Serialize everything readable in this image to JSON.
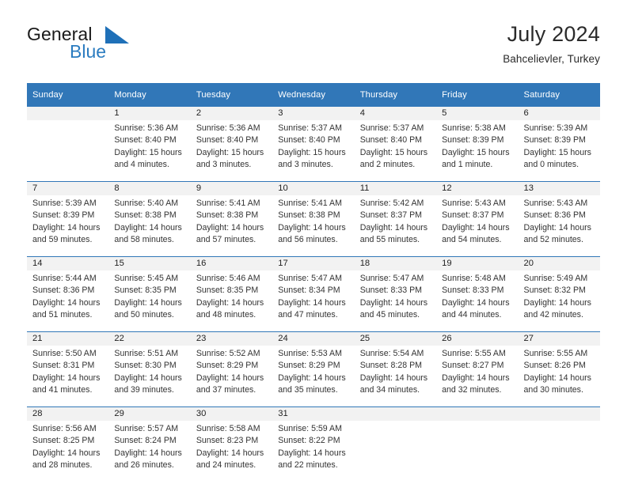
{
  "brand": {
    "line1": "General",
    "line2": "Blue",
    "triangle_icon": "brand-triangle-icon",
    "accent_color": "#2b7cc0"
  },
  "header": {
    "title": "July 2024",
    "subtitle": "Bahcelievler, Turkey"
  },
  "theme": {
    "header_blue": "#3177b8",
    "daynum_bg": "#f2f2f2",
    "text": "#333333"
  },
  "calendar": {
    "weekday_headers": [
      "Sunday",
      "Monday",
      "Tuesday",
      "Wednesday",
      "Thursday",
      "Friday",
      "Saturday"
    ],
    "weeks": [
      [
        {
          "day": "",
          "sunrise": "",
          "sunset": "",
          "daylight1": "",
          "daylight2": ""
        },
        {
          "day": "1",
          "sunrise": "Sunrise: 5:36 AM",
          "sunset": "Sunset: 8:40 PM",
          "daylight1": "Daylight: 15 hours",
          "daylight2": "and 4 minutes."
        },
        {
          "day": "2",
          "sunrise": "Sunrise: 5:36 AM",
          "sunset": "Sunset: 8:40 PM",
          "daylight1": "Daylight: 15 hours",
          "daylight2": "and 3 minutes."
        },
        {
          "day": "3",
          "sunrise": "Sunrise: 5:37 AM",
          "sunset": "Sunset: 8:40 PM",
          "daylight1": "Daylight: 15 hours",
          "daylight2": "and 3 minutes."
        },
        {
          "day": "4",
          "sunrise": "Sunrise: 5:37 AM",
          "sunset": "Sunset: 8:40 PM",
          "daylight1": "Daylight: 15 hours",
          "daylight2": "and 2 minutes."
        },
        {
          "day": "5",
          "sunrise": "Sunrise: 5:38 AM",
          "sunset": "Sunset: 8:39 PM",
          "daylight1": "Daylight: 15 hours",
          "daylight2": "and 1 minute."
        },
        {
          "day": "6",
          "sunrise": "Sunrise: 5:39 AM",
          "sunset": "Sunset: 8:39 PM",
          "daylight1": "Daylight: 15 hours",
          "daylight2": "and 0 minutes."
        }
      ],
      [
        {
          "day": "7",
          "sunrise": "Sunrise: 5:39 AM",
          "sunset": "Sunset: 8:39 PM",
          "daylight1": "Daylight: 14 hours",
          "daylight2": "and 59 minutes."
        },
        {
          "day": "8",
          "sunrise": "Sunrise: 5:40 AM",
          "sunset": "Sunset: 8:38 PM",
          "daylight1": "Daylight: 14 hours",
          "daylight2": "and 58 minutes."
        },
        {
          "day": "9",
          "sunrise": "Sunrise: 5:41 AM",
          "sunset": "Sunset: 8:38 PM",
          "daylight1": "Daylight: 14 hours",
          "daylight2": "and 57 minutes."
        },
        {
          "day": "10",
          "sunrise": "Sunrise: 5:41 AM",
          "sunset": "Sunset: 8:38 PM",
          "daylight1": "Daylight: 14 hours",
          "daylight2": "and 56 minutes."
        },
        {
          "day": "11",
          "sunrise": "Sunrise: 5:42 AM",
          "sunset": "Sunset: 8:37 PM",
          "daylight1": "Daylight: 14 hours",
          "daylight2": "and 55 minutes."
        },
        {
          "day": "12",
          "sunrise": "Sunrise: 5:43 AM",
          "sunset": "Sunset: 8:37 PM",
          "daylight1": "Daylight: 14 hours",
          "daylight2": "and 54 minutes."
        },
        {
          "day": "13",
          "sunrise": "Sunrise: 5:43 AM",
          "sunset": "Sunset: 8:36 PM",
          "daylight1": "Daylight: 14 hours",
          "daylight2": "and 52 minutes."
        }
      ],
      [
        {
          "day": "14",
          "sunrise": "Sunrise: 5:44 AM",
          "sunset": "Sunset: 8:36 PM",
          "daylight1": "Daylight: 14 hours",
          "daylight2": "and 51 minutes."
        },
        {
          "day": "15",
          "sunrise": "Sunrise: 5:45 AM",
          "sunset": "Sunset: 8:35 PM",
          "daylight1": "Daylight: 14 hours",
          "daylight2": "and 50 minutes."
        },
        {
          "day": "16",
          "sunrise": "Sunrise: 5:46 AM",
          "sunset": "Sunset: 8:35 PM",
          "daylight1": "Daylight: 14 hours",
          "daylight2": "and 48 minutes."
        },
        {
          "day": "17",
          "sunrise": "Sunrise: 5:47 AM",
          "sunset": "Sunset: 8:34 PM",
          "daylight1": "Daylight: 14 hours",
          "daylight2": "and 47 minutes."
        },
        {
          "day": "18",
          "sunrise": "Sunrise: 5:47 AM",
          "sunset": "Sunset: 8:33 PM",
          "daylight1": "Daylight: 14 hours",
          "daylight2": "and 45 minutes."
        },
        {
          "day": "19",
          "sunrise": "Sunrise: 5:48 AM",
          "sunset": "Sunset: 8:33 PM",
          "daylight1": "Daylight: 14 hours",
          "daylight2": "and 44 minutes."
        },
        {
          "day": "20",
          "sunrise": "Sunrise: 5:49 AM",
          "sunset": "Sunset: 8:32 PM",
          "daylight1": "Daylight: 14 hours",
          "daylight2": "and 42 minutes."
        }
      ],
      [
        {
          "day": "21",
          "sunrise": "Sunrise: 5:50 AM",
          "sunset": "Sunset: 8:31 PM",
          "daylight1": "Daylight: 14 hours",
          "daylight2": "and 41 minutes."
        },
        {
          "day": "22",
          "sunrise": "Sunrise: 5:51 AM",
          "sunset": "Sunset: 8:30 PM",
          "daylight1": "Daylight: 14 hours",
          "daylight2": "and 39 minutes."
        },
        {
          "day": "23",
          "sunrise": "Sunrise: 5:52 AM",
          "sunset": "Sunset: 8:29 PM",
          "daylight1": "Daylight: 14 hours",
          "daylight2": "and 37 minutes."
        },
        {
          "day": "24",
          "sunrise": "Sunrise: 5:53 AM",
          "sunset": "Sunset: 8:29 PM",
          "daylight1": "Daylight: 14 hours",
          "daylight2": "and 35 minutes."
        },
        {
          "day": "25",
          "sunrise": "Sunrise: 5:54 AM",
          "sunset": "Sunset: 8:28 PM",
          "daylight1": "Daylight: 14 hours",
          "daylight2": "and 34 minutes."
        },
        {
          "day": "26",
          "sunrise": "Sunrise: 5:55 AM",
          "sunset": "Sunset: 8:27 PM",
          "daylight1": "Daylight: 14 hours",
          "daylight2": "and 32 minutes."
        },
        {
          "day": "27",
          "sunrise": "Sunrise: 5:55 AM",
          "sunset": "Sunset: 8:26 PM",
          "daylight1": "Daylight: 14 hours",
          "daylight2": "and 30 minutes."
        }
      ],
      [
        {
          "day": "28",
          "sunrise": "Sunrise: 5:56 AM",
          "sunset": "Sunset: 8:25 PM",
          "daylight1": "Daylight: 14 hours",
          "daylight2": "and 28 minutes."
        },
        {
          "day": "29",
          "sunrise": "Sunrise: 5:57 AM",
          "sunset": "Sunset: 8:24 PM",
          "daylight1": "Daylight: 14 hours",
          "daylight2": "and 26 minutes."
        },
        {
          "day": "30",
          "sunrise": "Sunrise: 5:58 AM",
          "sunset": "Sunset: 8:23 PM",
          "daylight1": "Daylight: 14 hours",
          "daylight2": "and 24 minutes."
        },
        {
          "day": "31",
          "sunrise": "Sunrise: 5:59 AM",
          "sunset": "Sunset: 8:22 PM",
          "daylight1": "Daylight: 14 hours",
          "daylight2": "and 22 minutes."
        },
        {
          "day": "",
          "sunrise": "",
          "sunset": "",
          "daylight1": "",
          "daylight2": ""
        },
        {
          "day": "",
          "sunrise": "",
          "sunset": "",
          "daylight1": "",
          "daylight2": ""
        },
        {
          "day": "",
          "sunrise": "",
          "sunset": "",
          "daylight1": "",
          "daylight2": ""
        }
      ]
    ]
  }
}
